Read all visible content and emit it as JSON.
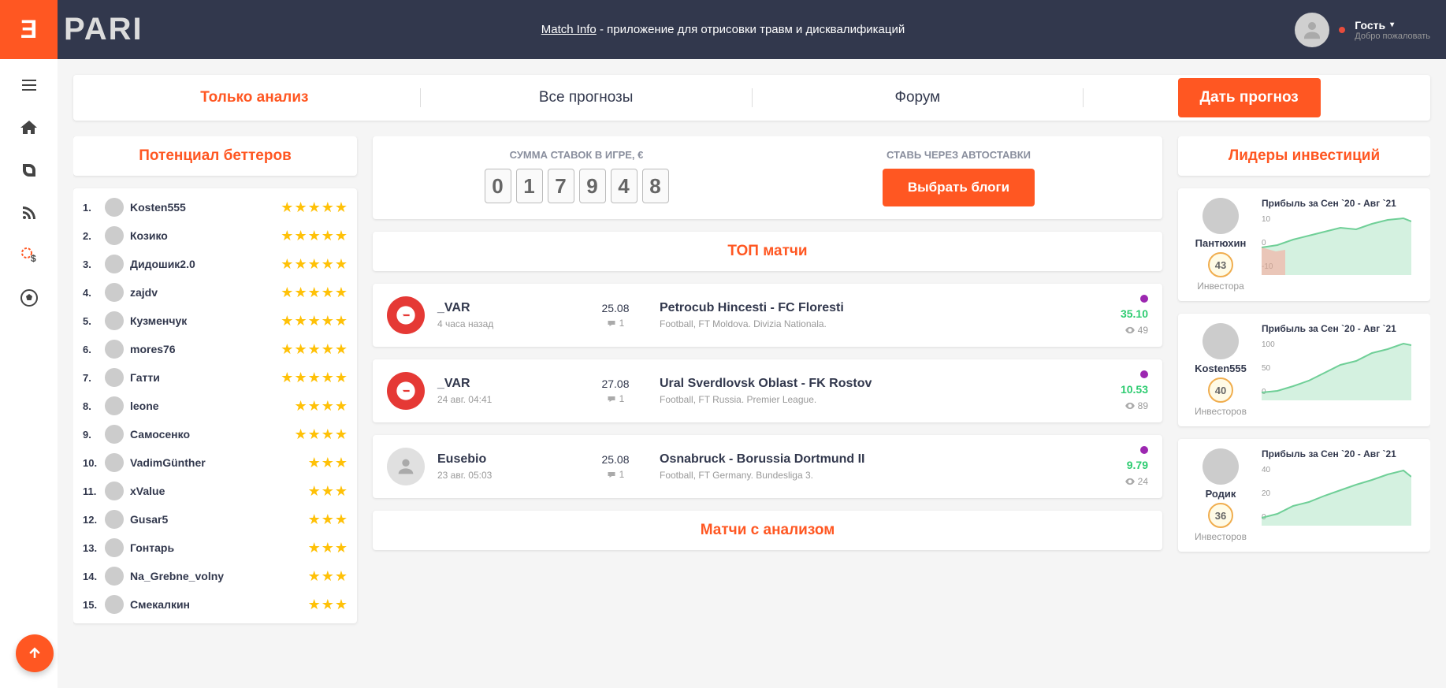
{
  "header": {
    "logo_prefix": "Ǝ",
    "logo_text": "PARI",
    "center_link": "Match Info",
    "center_text": " - приложение для отрисовки травм и дисквалификаций",
    "user_name": "Гость",
    "user_welcome": "Добро пожаловать"
  },
  "tabs": {
    "analysis": "Только анализ",
    "all": "Все прогнозы",
    "forum": "Форум",
    "give": "Дать прогноз"
  },
  "left": {
    "title": "Потенциал беттеров",
    "bettors": [
      {
        "n": "1.",
        "name": "Kosten555",
        "stars": 5
      },
      {
        "n": "2.",
        "name": "Козико",
        "stars": 5
      },
      {
        "n": "3.",
        "name": "Дидошик2.0",
        "stars": 5
      },
      {
        "n": "4.",
        "name": "zajdv",
        "stars": 5
      },
      {
        "n": "5.",
        "name": "Кузменчук",
        "stars": 5
      },
      {
        "n": "6.",
        "name": "mores76",
        "stars": 5
      },
      {
        "n": "7.",
        "name": "Гатти",
        "stars": 5
      },
      {
        "n": "8.",
        "name": "leone",
        "stars": 4
      },
      {
        "n": "9.",
        "name": "Самосенко",
        "stars": 4
      },
      {
        "n": "10.",
        "name": "VadimGünther",
        "stars": 3
      },
      {
        "n": "11.",
        "name": "xValue",
        "stars": 3
      },
      {
        "n": "12.",
        "name": "Gusar5",
        "stars": 3
      },
      {
        "n": "13.",
        "name": "Гонтарь",
        "stars": 3
      },
      {
        "n": "14.",
        "name": "Na_Grebne_volny",
        "stars": 3
      },
      {
        "n": "15.",
        "name": "Смекалкин",
        "stars": 3
      }
    ]
  },
  "center": {
    "sum_label": "СУММА СТАВОК В ИГРЕ, €",
    "digits": [
      "0",
      "1",
      "7",
      "9",
      "4",
      "8"
    ],
    "auto_label": "СТАВЬ ЧЕРЕЗ АВТОСТАВКИ",
    "auto_btn": "Выбрать блоги",
    "top_title": "ТОП матчи",
    "analysis_title": "Матчи с анализом",
    "matches": [
      {
        "author": "_VAR",
        "time": "4 часа назад",
        "date": "25.08",
        "comments": "1",
        "title": "Petrocub Hincesti - FC Floresti",
        "league": "Football, FT Moldova. Divizia Nationala.",
        "coef": "35.10",
        "views": "49",
        "red": true
      },
      {
        "author": "_VAR",
        "time": "24 авг. 04:41",
        "date": "27.08",
        "comments": "1",
        "title": "Ural Sverdlovsk Oblast - FK Rostov",
        "league": "Football, FT Russia. Premier League.",
        "coef": "10.53",
        "views": "89",
        "red": true
      },
      {
        "author": "Eusebio",
        "time": "23 авг. 05:03",
        "date": "25.08",
        "comments": "1",
        "title": "Osnabruck - Borussia Dortmund II",
        "league": "Football, FT Germany. Bundesliga 3.",
        "coef": "9.79",
        "views": "24",
        "red": false
      }
    ]
  },
  "right": {
    "title": "Лидеры инвестиций",
    "investors": [
      {
        "name": "Пантюхин",
        "badge": "43",
        "label": "Инвестора",
        "chart_title": "Прибыль за Сен `20 - Авг `21",
        "ticks": [
          "10",
          "0",
          "-10"
        ]
      },
      {
        "name": "Kosten555",
        "badge": "40",
        "label": "Инвесторов",
        "chart_title": "Прибыль за Сен `20 - Авг `21",
        "ticks": [
          "100",
          "50",
          "0"
        ]
      },
      {
        "name": "Родик",
        "badge": "36",
        "label": "Инвесторов",
        "chart_title": "Прибыль за Сен `20 - Авг `21",
        "ticks": [
          "40",
          "20",
          "0"
        ]
      }
    ]
  }
}
